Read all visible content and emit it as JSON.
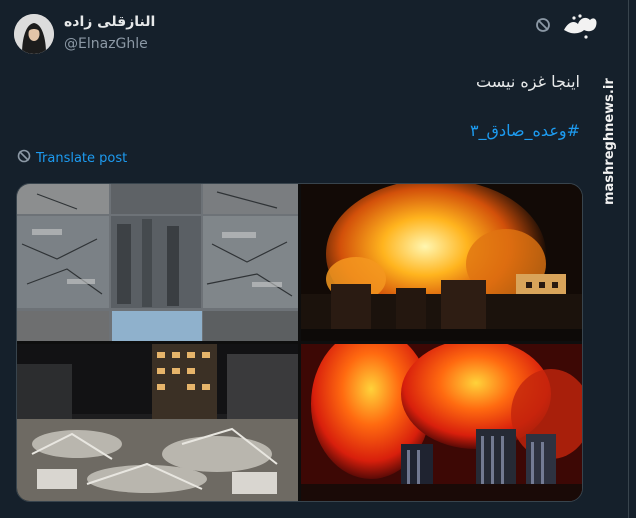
{
  "tweet": {
    "display_name": "النازقلی زاده",
    "handle": "@ElnazGhle",
    "text": "اینجا غزه نیست",
    "hashtag": "#وعده_صادق_۳",
    "translate_label": "Translate post"
  },
  "watermark": {
    "logo_text": "مشرق",
    "site": "mashreghnews.ir"
  },
  "colors": {
    "background": "#15202b",
    "text": "#e7e9ea",
    "muted": "#8b98a5",
    "link": "#1d9bf0",
    "border": "#38444d"
  },
  "icons": [
    "translate-icon",
    "avatar"
  ],
  "media": {
    "tiles": [
      "rubble-collage",
      "building-fire-explosion",
      "destroyed-street-night",
      "city-fire-skyline"
    ]
  }
}
